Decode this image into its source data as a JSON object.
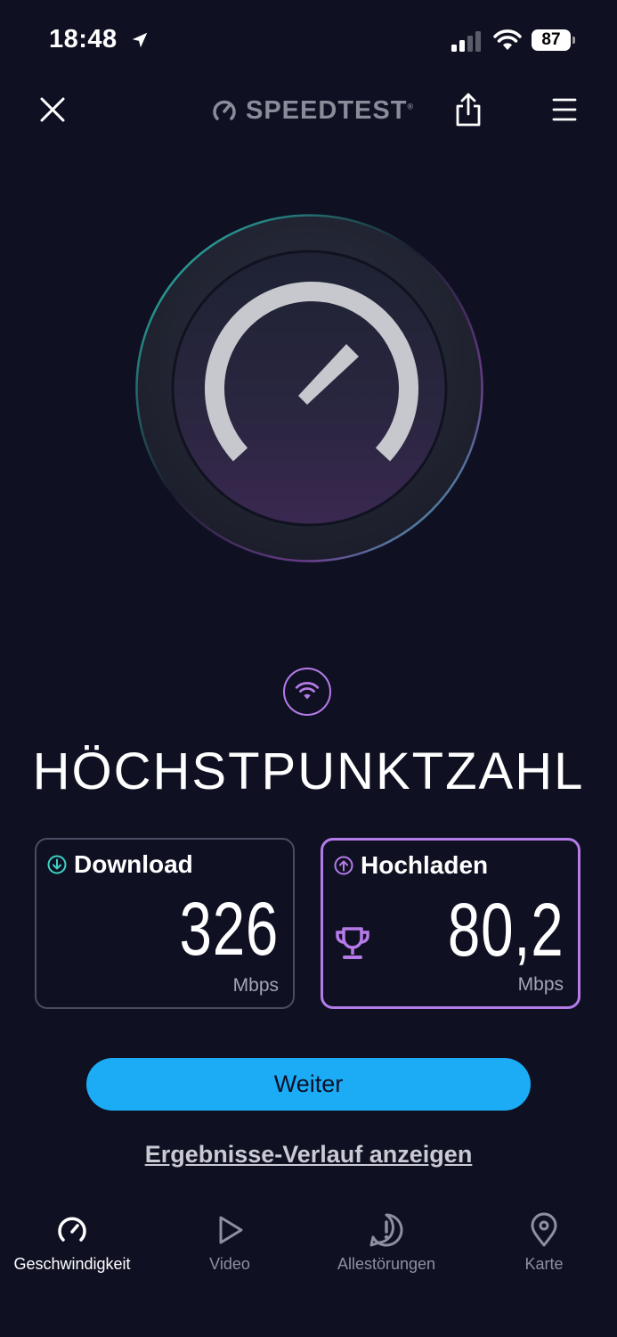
{
  "status_bar": {
    "time": "18:48",
    "battery": "87"
  },
  "header": {
    "brand": "SPEEDTEST",
    "brand_mark": "®"
  },
  "result": {
    "title": "HÖCHSTPUNKTZAHL",
    "download": {
      "label": "Download",
      "value": "326",
      "unit": "Mbps"
    },
    "upload": {
      "label": "Hochladen",
      "value": "80,2",
      "unit": "Mbps"
    }
  },
  "actions": {
    "continue_label": "Weiter",
    "history_label": "Ergebnisse-Verlauf anzeigen"
  },
  "nav": {
    "items": [
      {
        "label": "Geschwindigkeit",
        "icon": "gauge-icon",
        "active": true
      },
      {
        "label": "Video",
        "icon": "play-icon"
      },
      {
        "label": "Allestörungen",
        "icon": "alert-icon"
      },
      {
        "label": "Karte",
        "icon": "map-pin-icon"
      }
    ]
  },
  "colors": {
    "background": "#0f1123",
    "accent_blue": "#1bacf5",
    "accent_purple": "#b57be8",
    "download_icon": "#3fd1c4"
  }
}
